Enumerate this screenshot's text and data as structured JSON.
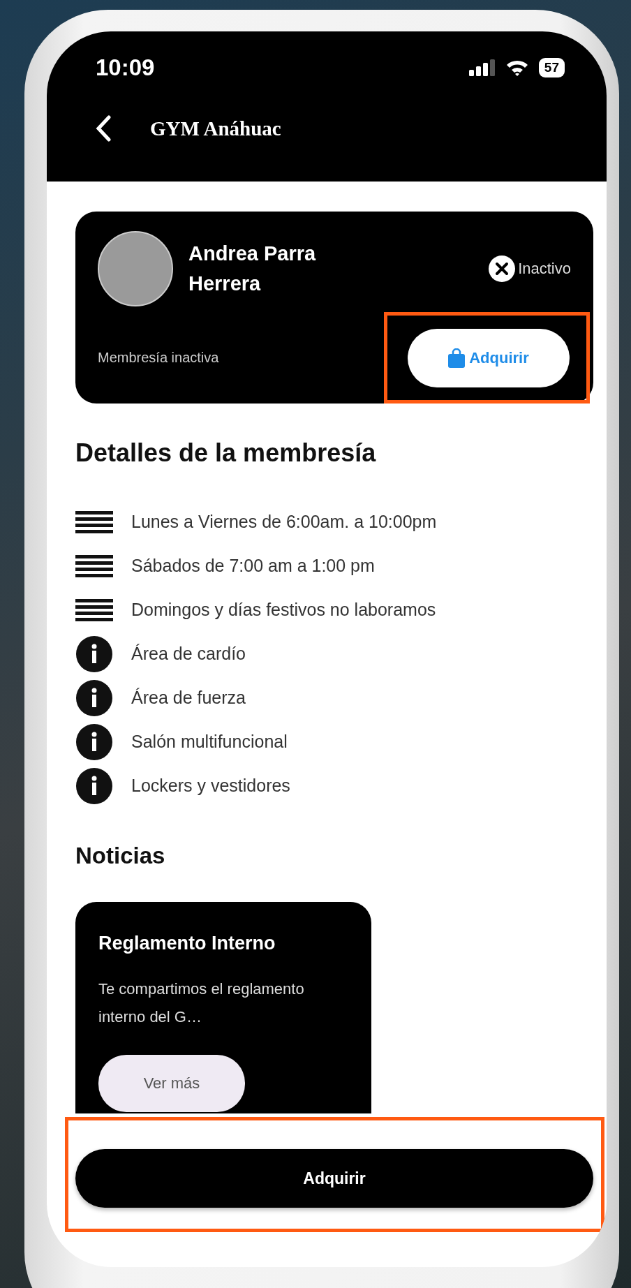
{
  "status_bar": {
    "time": "10:09",
    "battery": "57"
  },
  "header": {
    "title": "GYM Anáhuac"
  },
  "member_card": {
    "name": "Andrea Parra Herrera",
    "status": "Inactivo",
    "membership": "Membresía inactiva",
    "button": {
      "label": "Adquirir",
      "highlighted": true
    }
  },
  "details": {
    "title": "Detalles de la membresía",
    "items": [
      {
        "kind": "schedule",
        "text": "Lunes a Viernes de 6:00am. a 10:00pm"
      },
      {
        "kind": "schedule",
        "text": "Sábados de 7:00 am a 1:00 pm"
      },
      {
        "kind": "schedule",
        "text": "Domingos y días festivos no laboramos"
      },
      {
        "kind": "info",
        "text": "Área de cardío"
      },
      {
        "kind": "info",
        "text": "Área de fuerza"
      },
      {
        "kind": "info",
        "text": "Salón multifuncional"
      },
      {
        "kind": "info",
        "text": "Lockers y vestidores"
      }
    ]
  },
  "news": {
    "title": "Noticias",
    "cards": [
      {
        "title": "Reglamento Interno",
        "body": "Te compartimos el reglamento interno del G…",
        "button": "Ver más"
      }
    ]
  },
  "footer": {
    "button": {
      "label": "Adquirir",
      "highlighted": true
    }
  }
}
